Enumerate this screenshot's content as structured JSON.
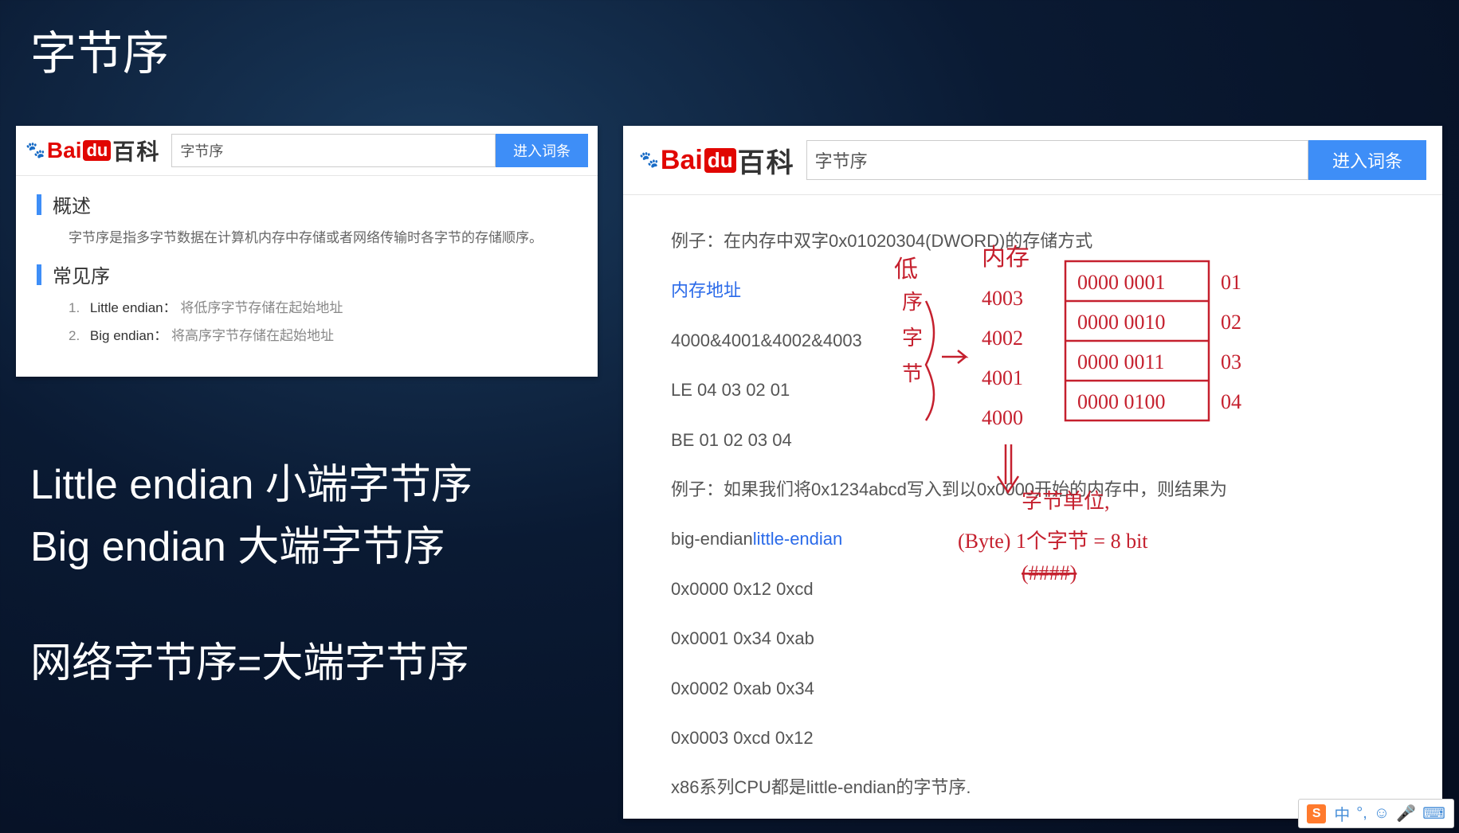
{
  "slide": {
    "title": "字节序",
    "line1": "Little endian 小端字节序",
    "line2": "Big endian   大端字节序",
    "line3": "网络字节序=大端字节序"
  },
  "left_panel": {
    "logo": {
      "bai": "Bai",
      "du": "du",
      "baike": "百科"
    },
    "search_value": "字节序",
    "search_button": "进入词条",
    "section1": {
      "title": "概述",
      "desc": "字节序是指多字节数据在计算机内存中存储或者网络传输时各字节的存储顺序。"
    },
    "section2": {
      "title": "常见序",
      "items": [
        {
          "num": "1.",
          "term": "Little endian：",
          "def": "将低序字节存储在起始地址"
        },
        {
          "num": "2.",
          "term": "Big endian：",
          "def": "将高序字节存储在起始地址"
        }
      ]
    }
  },
  "right_panel": {
    "logo": {
      "bai": "Bai",
      "du": "du",
      "baike": "百科"
    },
    "search_value": "字节序",
    "search_button": "进入词条",
    "lines": {
      "ex1": "例子：在内存中双字0x01020304(DWORD)的存储方式",
      "memaddr_label": "内存地址",
      "addrs": "4000&4001&4002&4003",
      "le": "LE 04 03 02 01",
      "be": "BE 01 02 03 04",
      "ex2": "例子：如果我们将0x1234abcd写入到以0x0000开始的内存中，则结果为",
      "big": "big-endian",
      "little": "little-endian",
      "r0": "0x0000 0x12 0xcd",
      "r1": "0x0001 0x34 0xab",
      "r2": "0x0002 0xab 0x34",
      "r3": "0x0003 0xcd 0x12",
      "cpu": "x86系列CPU都是little-endian的字节序."
    }
  },
  "annotations": {
    "col_low": "低",
    "mem": "内存",
    "addr3": "4003",
    "addr2": "4002",
    "addr1": "4001",
    "addr0": "4000",
    "cell0": "0000 0001",
    "cell1": "0000 0010",
    "cell2": "0000 0011",
    "cell3": "0000 0100",
    "v1": "01",
    "v2": "02",
    "v3": "03",
    "v4": "04",
    "unit": "字节单位,",
    "byte": "(Byte) 1个字节 = 8 bit",
    "scratch": "(####)"
  },
  "ime": {
    "brand": "S",
    "items": [
      "中",
      "°,",
      "☺",
      "🎤",
      "⌨"
    ]
  }
}
